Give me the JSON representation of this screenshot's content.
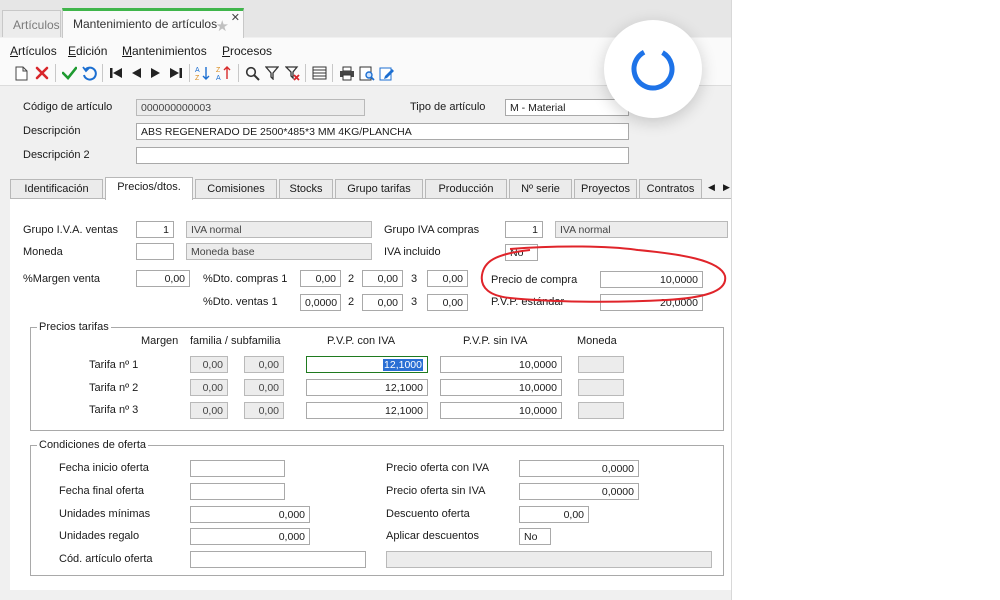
{
  "window_tabs": [
    {
      "label": "Artículos"
    },
    {
      "label": "Mantenimiento de artículos"
    }
  ],
  "menu": [
    {
      "label": "Artículos",
      "accel": "A"
    },
    {
      "label": "Edición",
      "accel": "E"
    },
    {
      "label": "Mantenimientos",
      "accel": "M"
    },
    {
      "label": "Procesos",
      "accel": "P"
    }
  ],
  "toolbar": {
    "icons": [
      "new-icon",
      "delete-icon",
      "confirm-icon",
      "undo-icon",
      "first-icon",
      "previous-icon",
      "next-icon",
      "last-icon",
      "sort-icon",
      "sort-desc-icon",
      "search-icon",
      "filter-icon",
      "clear-filter-icon",
      "grid-icon",
      "print-icon",
      "preview-icon",
      "edit-icon"
    ]
  },
  "header": {
    "codigo_label": "Código de artículo",
    "codigo_value": "000000000003",
    "tipo_label": "Tipo de artículo",
    "tipo_value": "M  - Material",
    "descripcion_label": "Descripción",
    "descripcion_value": "ABS REGENERADO DE 2500*485*3 MM 4KG/PLANCHA",
    "descripcion2_label": "Descripción 2",
    "descripcion2_value": ""
  },
  "tabs": [
    {
      "label": "Identificación"
    },
    {
      "label": "Precios/dtos."
    },
    {
      "label": "Comisiones"
    },
    {
      "label": "Stocks"
    },
    {
      "label": "Grupo tarifas"
    },
    {
      "label": "Producción"
    },
    {
      "label": "Nº serie"
    },
    {
      "label": "Proyectos"
    },
    {
      "label": "Contratos"
    }
  ],
  "precios": {
    "grupo_iva_ventas_label": "Grupo I.V.A. ventas",
    "grupo_iva_ventas_code": "1",
    "grupo_iva_ventas_desc": "IVA normal",
    "grupo_iva_compras_label": "Grupo IVA compras",
    "grupo_iva_compras_code": "1",
    "grupo_iva_compras_desc": "IVA normal",
    "moneda_label": "Moneda",
    "moneda_code": "",
    "moneda_desc": "Moneda base",
    "iva_incluido_label": "IVA incluido",
    "iva_incluido_value": "No",
    "margen_venta_label": "%Margen venta",
    "margen_venta_value": "0,00",
    "dto_compras_label": "%Dto. compras 1",
    "dto_compras": [
      "0,00",
      "0,00",
      "0,00"
    ],
    "dto_ventas_label": "%Dto. ventas  1",
    "dto_ventas": [
      "0,0000",
      "0,00",
      "0,00"
    ],
    "idx2": "2",
    "idx3": "3",
    "precio_compra_label": "Precio de compra",
    "precio_compra_value": "10,0000",
    "pvp_estandar_label": "P.V.P. estándar",
    "pvp_estandar_value": "20,0000"
  },
  "tarifas": {
    "title": "Precios tarifas",
    "headers": {
      "margen": "Margen",
      "familia": "familia / subfamilia",
      "pvp_con": "P.V.P. con IVA",
      "pvp_sin": "P.V.P. sin IVA",
      "moneda": "Moneda"
    },
    "rows": [
      {
        "label": "Tarifa nº 1",
        "margen": "0,00",
        "familia": "0,00",
        "pvp_con": "12,1000",
        "pvp_sin": "10,0000",
        "moneda": ""
      },
      {
        "label": "Tarifa nº 2",
        "margen": "0,00",
        "familia": "0,00",
        "pvp_con": "12,1000",
        "pvp_sin": "10,0000",
        "moneda": ""
      },
      {
        "label": "Tarifa nº 3",
        "margen": "0,00",
        "familia": "0,00",
        "pvp_con": "12,1000",
        "pvp_sin": "10,0000",
        "moneda": ""
      }
    ]
  },
  "oferta": {
    "title": "Condiciones de oferta",
    "fecha_inicio_label": "Fecha inicio oferta",
    "fecha_inicio_value": "",
    "fecha_final_label": "Fecha final oferta",
    "fecha_final_value": "",
    "unidades_minimas_label": "Unidades mínimas",
    "unidades_minimas_value": "0,000",
    "unidades_regalo_label": "Unidades regalo",
    "unidades_regalo_value": "0,000",
    "cod_articulo_label": "Cód. artículo oferta",
    "cod_articulo_value": "",
    "cod_articulo_desc": "",
    "precio_con_iva_label": "Precio oferta con IVA",
    "precio_con_iva_value": "0,0000",
    "precio_sin_iva_label": "Precio oferta sin IVA",
    "precio_sin_iva_value": "0,0000",
    "descuento_label": "Descuento oferta",
    "descuento_value": "0,00",
    "aplicar_label": "Aplicar descuentos",
    "aplicar_value": "No"
  },
  "colors": {
    "accent_green": "#3fb54a",
    "annotation_red": "#e0242a",
    "loader_blue": "#1e73e8"
  }
}
